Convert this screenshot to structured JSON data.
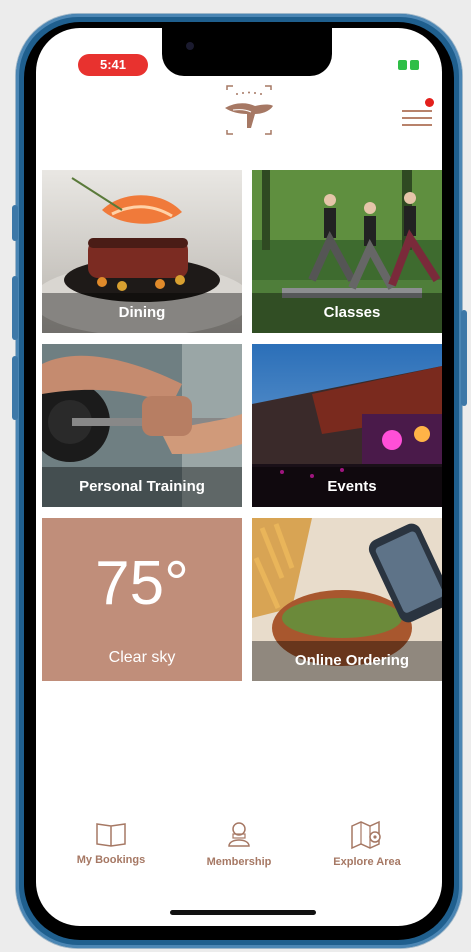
{
  "status_bar": {
    "time": "5:41"
  },
  "tiles": [
    {
      "label": "Dining"
    },
    {
      "label": "Classes"
    },
    {
      "label": "Personal Training"
    },
    {
      "label": "Events"
    },
    {
      "label": "Online Ordering"
    }
  ],
  "weather": {
    "temperature": "75°",
    "condition": "Clear sky"
  },
  "tabbar": {
    "items": [
      {
        "label": "My Bookings",
        "icon": "book-icon"
      },
      {
        "label": "Membership",
        "icon": "person-badge-icon"
      },
      {
        "label": "Explore Area",
        "icon": "map-pin-icon"
      }
    ]
  },
  "colors": {
    "accent": "#b8826b",
    "weather_tile": "#c08e7a",
    "notification": "#e3201c"
  }
}
